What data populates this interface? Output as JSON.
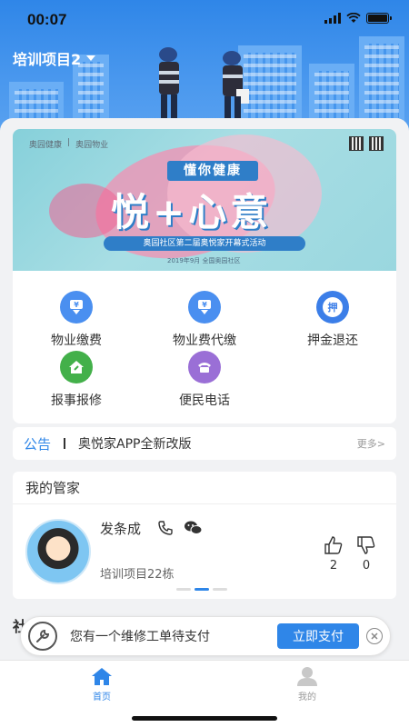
{
  "status_bar": {
    "time": "00:07"
  },
  "header": {
    "project_name": "培训项目2"
  },
  "banner": {
    "logo_left": "奥园健康",
    "logo_right": "奥园物业",
    "tag": "懂你健康",
    "title": "悦+心意",
    "subtitle": "奥园社区第二届奥悦家开幕式活动",
    "date_line": "2019年9月 全国奥园社区"
  },
  "services": [
    {
      "label": "物业缴费",
      "icon": "yen-down-icon",
      "color": "#4a8ff0"
    },
    {
      "label": "物业费代缴",
      "icon": "yen-down-icon",
      "color": "#4a8ff0"
    },
    {
      "label": "押金退还",
      "icon": "deposit-icon",
      "glyph": "押",
      "color": "#3b7ee8"
    },
    {
      "label": "报事报修",
      "icon": "house-repair-icon",
      "color": "#43b04a"
    },
    {
      "label": "便民电话",
      "icon": "telephone-icon",
      "color": "#9a6fd6"
    }
  ],
  "notice": {
    "tag": "公告",
    "text": "奥悦家APP全新改版",
    "more": "更多>"
  },
  "steward": {
    "section_title": "我的管家",
    "name": "发条成",
    "project": "培训项目22栋",
    "likes": "2",
    "dislikes": "0"
  },
  "next_section_peek": "社",
  "pay_bar": {
    "text": "您有一个维修工单待支付",
    "button": "立即支付"
  },
  "tabbar": [
    {
      "label": "首页",
      "icon": "home-icon",
      "active": true,
      "color": "#2f86e8"
    },
    {
      "label": "我的",
      "icon": "user-icon",
      "active": false,
      "color": "#999999"
    }
  ]
}
